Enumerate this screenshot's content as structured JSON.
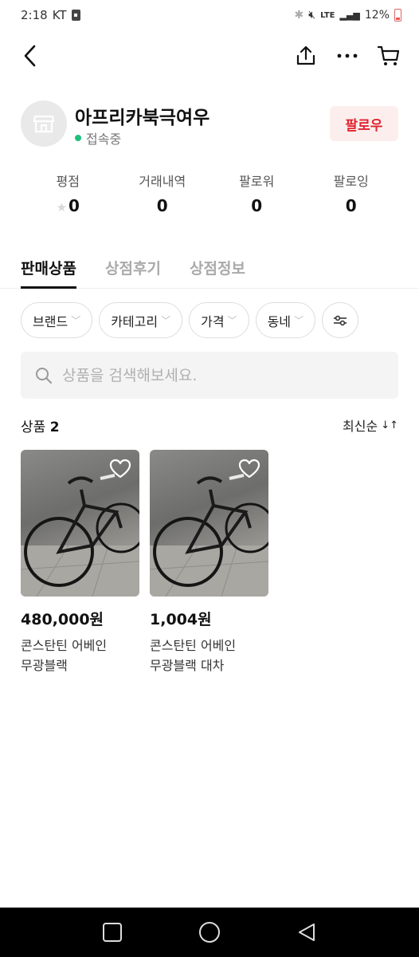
{
  "status_bar": {
    "time": "2:18",
    "carrier": "KT",
    "network": "LTE",
    "battery": "12%"
  },
  "header": {
    "back_icon": "chevron-left-icon",
    "share_icon": "share-icon",
    "more_icon": "more-icon",
    "cart_icon": "cart-icon"
  },
  "profile": {
    "shop_name": "아프리카북극여우",
    "status": "접속중",
    "status_color": "#1fbf7c",
    "follow_label": "팔로우",
    "follow_color": "#e0242f"
  },
  "stats": [
    {
      "label": "평점",
      "value": "0"
    },
    {
      "label": "거래내역",
      "value": "0"
    },
    {
      "label": "팔로워",
      "value": "0"
    },
    {
      "label": "팔로잉",
      "value": "0"
    }
  ],
  "tabs": [
    {
      "label": "판매상품",
      "active": true
    },
    {
      "label": "상점후기",
      "active": false
    },
    {
      "label": "상점정보",
      "active": false
    }
  ],
  "filters": [
    {
      "label": "브랜드"
    },
    {
      "label": "카테고리"
    },
    {
      "label": "가격"
    },
    {
      "label": "동네"
    }
  ],
  "search": {
    "placeholder": "상품을 검색해보세요."
  },
  "list": {
    "count_label": "상품",
    "count": "2",
    "sort_label": "최신순"
  },
  "products": [
    {
      "price": "480,000원",
      "title_line1": "콘스탄틴 어베인",
      "title_line2": "무광블랙"
    },
    {
      "price": "1,004원",
      "title_line1": "콘스탄틴 어베인",
      "title_line2": "무광블랙 대차"
    }
  ]
}
